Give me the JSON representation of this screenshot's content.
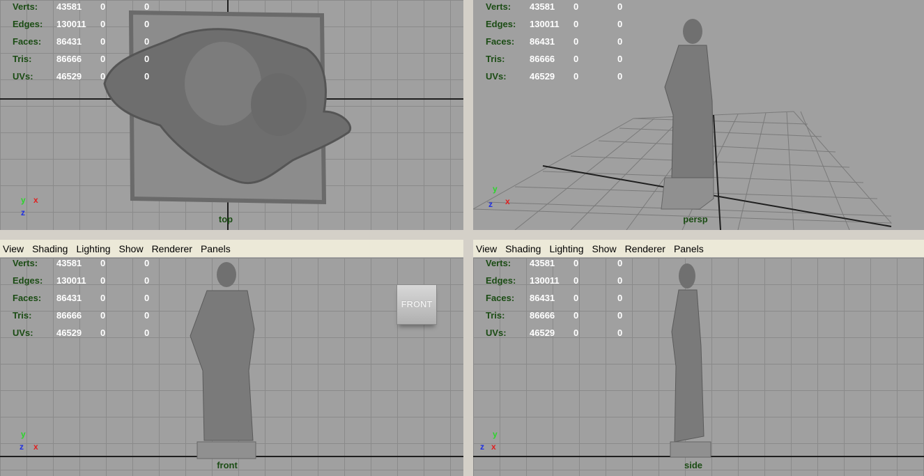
{
  "menu": [
    "View",
    "Shading",
    "Lighting",
    "Show",
    "Renderer",
    "Panels"
  ],
  "hud": {
    "labels": [
      "Verts:",
      "Edges:",
      "Faces:",
      "Tris:",
      "UVs:"
    ],
    "rows": [
      {
        "label": "Verts:",
        "v1": "43581",
        "v2": "0",
        "v3": "0"
      },
      {
        "label": "Edges:",
        "v1": "130011",
        "v2": "0",
        "v3": "0"
      },
      {
        "label": "Faces:",
        "v1": "86431",
        "v2": "0",
        "v3": "0"
      },
      {
        "label": "Tris:",
        "v1": "86666",
        "v2": "0",
        "v3": "0"
      },
      {
        "label": "UVs:",
        "v1": "46529",
        "v2": "0",
        "v3": "0"
      }
    ]
  },
  "viewports": {
    "top": {
      "camera": "top"
    },
    "persp": {
      "camera": "persp"
    },
    "front": {
      "camera": "front",
      "viewcube": "FRONT"
    },
    "side": {
      "camera": "side"
    }
  },
  "axes": {
    "x": "x",
    "y": "y",
    "z": "z"
  },
  "colors": {
    "viewport_bg": "#a0a0a0",
    "hud_label": "#1b4c14",
    "axis_x": "#e02020",
    "axis_y": "#2bd62b",
    "axis_z": "#2030e0"
  }
}
